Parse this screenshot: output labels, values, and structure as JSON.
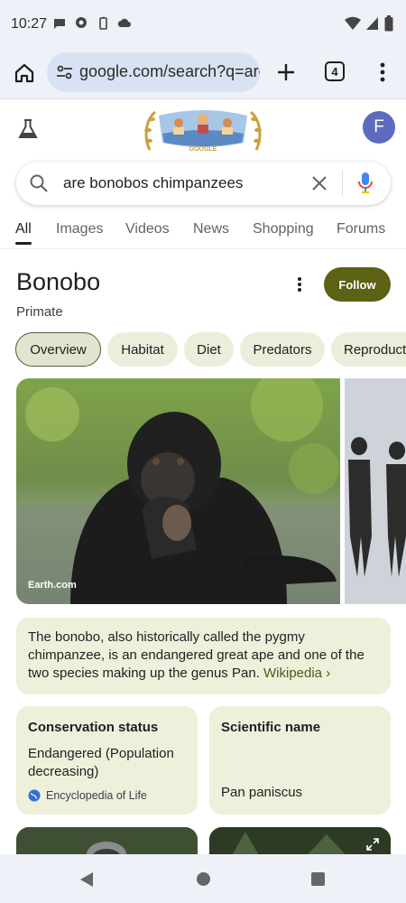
{
  "status_bar": {
    "time": "10:27",
    "left_icons": [
      "message-icon",
      "chat-icon",
      "battery-saver-icon",
      "cloud-icon"
    ],
    "right_icons": [
      "wifi-icon",
      "signal-icon",
      "battery-icon"
    ]
  },
  "browser": {
    "url": "google.com/search?q=are+bonobos+chimpanzees",
    "tab_count": "4",
    "icons": [
      "home-icon",
      "site-settings-icon",
      "new-tab-icon",
      "menu-icon"
    ]
  },
  "google": {
    "avatar_letter": "F",
    "doodle_text": "GOOGLE",
    "search_query": "are bonobos chimpanzees"
  },
  "tabs": [
    "All",
    "Images",
    "Videos",
    "News",
    "Shopping",
    "Forums"
  ],
  "active_tab": "All",
  "knowledge_panel": {
    "title": "Bonobo",
    "subtitle": "Primate",
    "follow_label": "Follow",
    "chips": [
      "Overview",
      "Habitat",
      "Diet",
      "Predators",
      "Reproduction"
    ],
    "active_chip": "Overview",
    "image_credit": "Earth.com",
    "description": "The bonobo, also historically called the pygmy chimpanzee, is an endangered great ape and one of the two species making up the genus Pan.",
    "wiki_link": "Wikipedia ›",
    "facts": [
      {
        "title": "Conservation status",
        "value": "Endangered (Population decreasing)",
        "source": "Encyclopedia of Life"
      },
      {
        "title": "Scientific name",
        "value": "Pan paniscus"
      }
    ]
  },
  "colors": {
    "accent_olive": "#5c6113",
    "card_bg": "#eef0dc",
    "avatar_bg": "#5c6bc0",
    "chrome_bg": "#eef1f8"
  }
}
